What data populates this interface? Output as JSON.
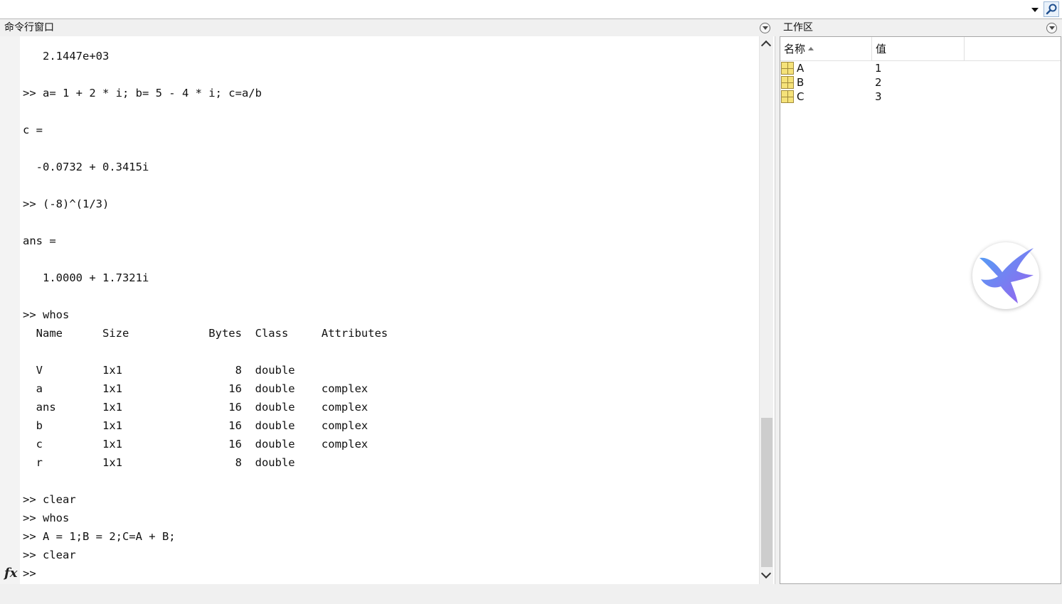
{
  "command_window": {
    "title": "命令行窗口",
    "lines": [
      "   2.1447e+03",
      "",
      ">> a= 1 + 2 * i; b= 5 - 4 * i; c=a/b",
      "",
      "c =",
      "",
      "  -0.0732 + 0.3415i",
      "",
      ">> (-8)^(1/3)",
      "",
      "ans =",
      "",
      "   1.0000 + 1.7321i",
      "",
      ">> whos",
      "  Name      Size            Bytes  Class     Attributes",
      "",
      "  V         1x1                 8  double",
      "  a         1x1                16  double    complex",
      "  ans       1x1                16  double    complex",
      "  b         1x1                16  double    complex",
      "  c         1x1                16  double    complex",
      "  r         1x1                 8  double",
      "",
      ">> clear",
      ">> whos",
      ">> A = 1;B = 2;C=A + B;",
      ">> clear",
      ">>"
    ],
    "fx_label": "fx"
  },
  "workspace": {
    "title": "工作区",
    "columns": {
      "name": "名称",
      "value": "值"
    },
    "variables": [
      {
        "name": "A",
        "value": "1"
      },
      {
        "name": "B",
        "value": "2"
      },
      {
        "name": "C",
        "value": "3"
      }
    ]
  },
  "icons": {
    "panel_menu": "circle-chevron-down-icon",
    "search": "magnifier-icon",
    "variable": "matrix-grid-icon",
    "logo": "hummingbird-logo"
  },
  "colors": {
    "logo_gradient_start": "#4fa0f5",
    "logo_gradient_end": "#9a62ee"
  }
}
